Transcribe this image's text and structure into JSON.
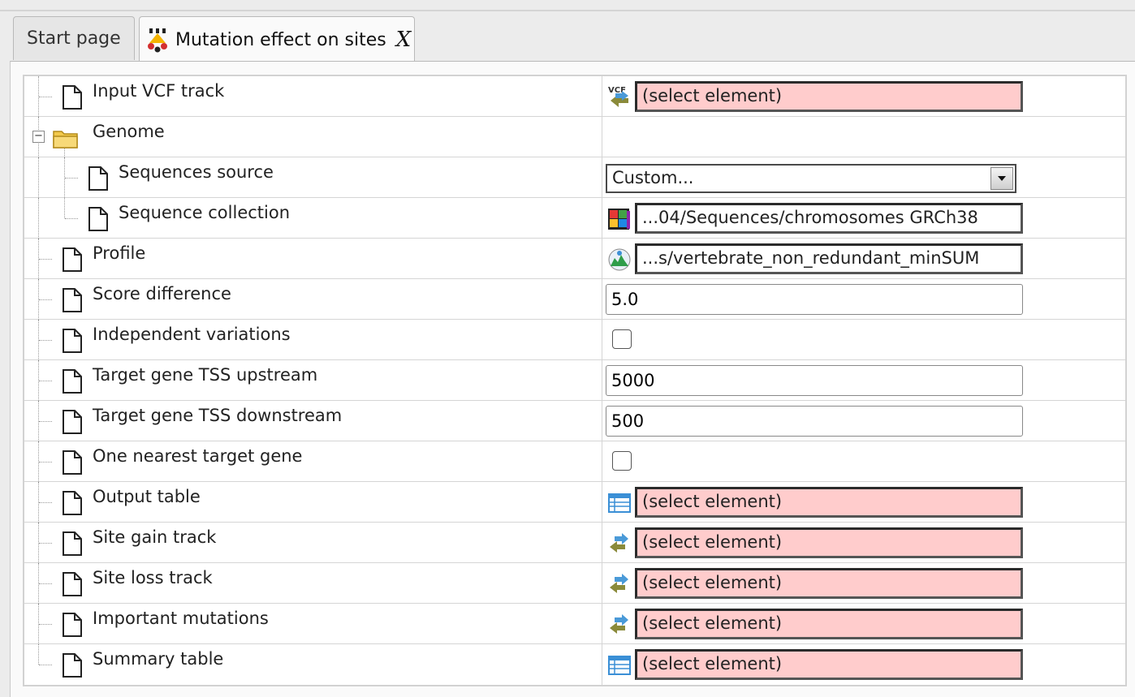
{
  "tabs": [
    {
      "label": "Start page",
      "active": false
    },
    {
      "label": "Mutation effect on sites",
      "active": true,
      "close": "X",
      "icon": "workflow-icon"
    }
  ],
  "rows": [
    {
      "label": "Input VCF track",
      "level": 1,
      "kind": "select",
      "value": "(select element)",
      "empty": true,
      "icon": "vcf-track-icon"
    },
    {
      "label": "Genome",
      "level": 1,
      "kind": "group",
      "icon": "folder-icon"
    },
    {
      "label": "Sequences source",
      "level": 2,
      "kind": "combo",
      "value": "Custom..."
    },
    {
      "label": "Sequence collection",
      "level": 2,
      "kind": "select",
      "value": "...04/Sequences/chromosomes GRCh38",
      "empty": false,
      "icon": "sequence-collection-icon"
    },
    {
      "label": "Profile",
      "level": 1,
      "kind": "select",
      "value": "...s/vertebrate_non_redundant_minSUM",
      "empty": false,
      "icon": "profile-icon"
    },
    {
      "label": "Score difference",
      "level": 1,
      "kind": "text",
      "value": "5.0"
    },
    {
      "label": "Independent variations",
      "level": 1,
      "kind": "checkbox",
      "checked": false
    },
    {
      "label": "Target gene TSS upstream",
      "level": 1,
      "kind": "text",
      "value": "5000"
    },
    {
      "label": "Target gene TSS downstream",
      "level": 1,
      "kind": "text",
      "value": "500"
    },
    {
      "label": "One nearest target gene",
      "level": 1,
      "kind": "checkbox",
      "checked": false
    },
    {
      "label": "Output table",
      "level": 1,
      "kind": "select",
      "value": "(select element)",
      "empty": true,
      "icon": "table-icon"
    },
    {
      "label": "Site gain track",
      "level": 1,
      "kind": "select",
      "value": "(select element)",
      "empty": true,
      "icon": "track-icon"
    },
    {
      "label": "Site loss track",
      "level": 1,
      "kind": "select",
      "value": "(select element)",
      "empty": true,
      "icon": "track-icon"
    },
    {
      "label": "Important mutations",
      "level": 1,
      "kind": "select",
      "value": "(select element)",
      "empty": true,
      "icon": "track-icon"
    },
    {
      "label": "Summary table",
      "level": 1,
      "kind": "select",
      "value": "(select element)",
      "empty": true,
      "icon": "table-icon"
    }
  ],
  "colors": {
    "empty_field": "#ffcccc",
    "accent": "#3a8fd6"
  }
}
